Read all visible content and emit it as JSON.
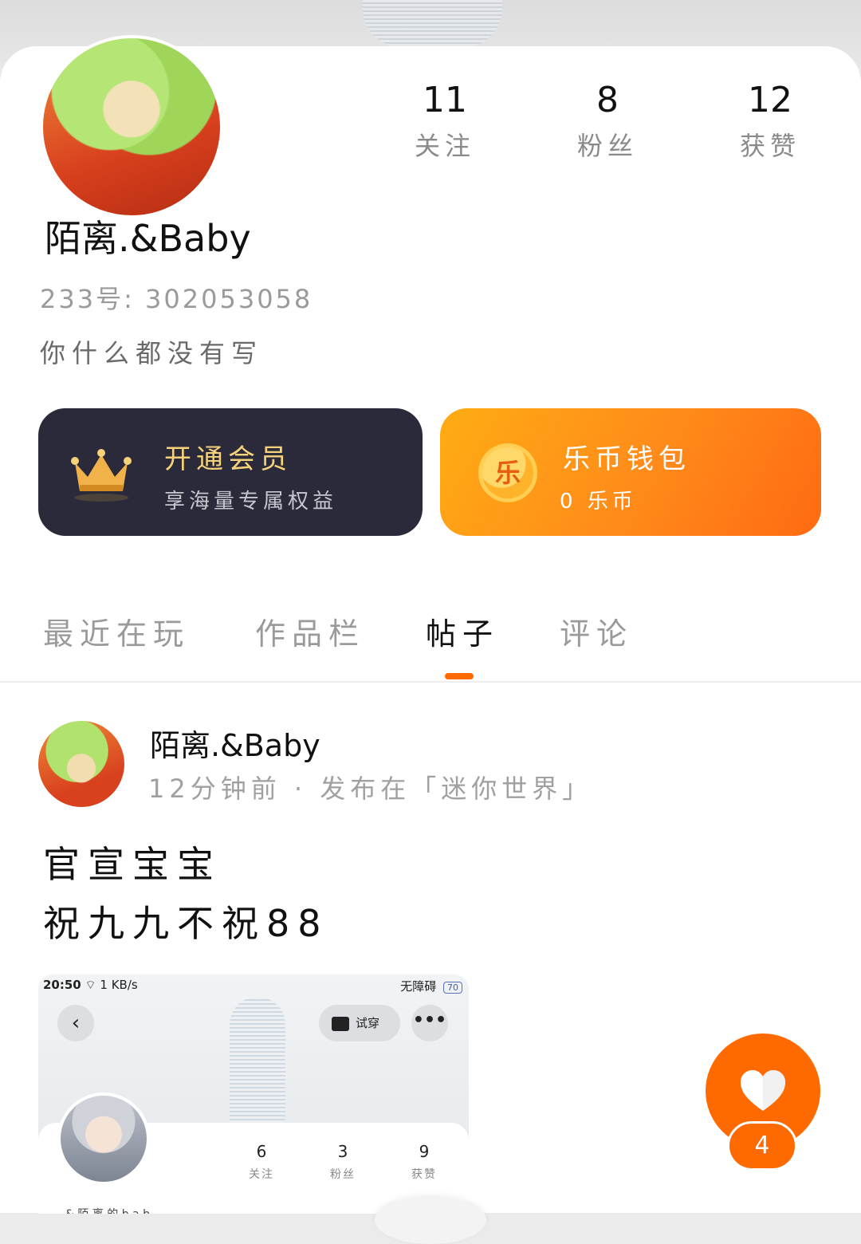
{
  "profile": {
    "username": "陌离.&Baby",
    "uid": "233号: 302053058",
    "bio": "你什么都没有写",
    "stats": [
      {
        "num": "11",
        "label": "关注"
      },
      {
        "num": "8",
        "label": "粉丝"
      },
      {
        "num": "12",
        "label": "获赞"
      }
    ]
  },
  "cards": {
    "vip": {
      "title": "开通会员",
      "subtitle": "享海量专属权益"
    },
    "wallet": {
      "coin_glyph": "乐",
      "title": "乐币钱包",
      "subtitle": "0 乐币"
    }
  },
  "tabs": [
    {
      "label": "最近在玩"
    },
    {
      "label": "作品栏"
    },
    {
      "label": "帖子"
    },
    {
      "label": "评论"
    }
  ],
  "active_tab": "帖子",
  "post": {
    "author": "陌离.&Baby",
    "meta": "12分钟前 · 发布在「迷你世界」",
    "lines": [
      "官宣宝宝",
      "祝九九不祝88"
    ],
    "screenshot": {
      "time": "20:50",
      "network": "1 KB/s",
      "accessibility": "无障碍",
      "battery": "70",
      "back_glyph": "‹",
      "try_label": "试穿",
      "more_glyph": "•••",
      "stats": [
        {
          "num": "6",
          "label": "关注"
        },
        {
          "num": "3",
          "label": "粉丝"
        },
        {
          "num": "9",
          "label": "获赞"
        }
      ],
      "truncated_name": "& 陌 离 的 b a b"
    },
    "like_count": "4"
  },
  "colors": {
    "accent": "#ff6a00",
    "vip_bg": "#2a2a3a",
    "vip_gold": "#f7d27a",
    "wallet_start": "#ffac14",
    "wallet_end": "#ff6a12"
  },
  "icons": {
    "crown": "crown-icon",
    "coin": "coin-icon",
    "heart": "heart-icon"
  }
}
